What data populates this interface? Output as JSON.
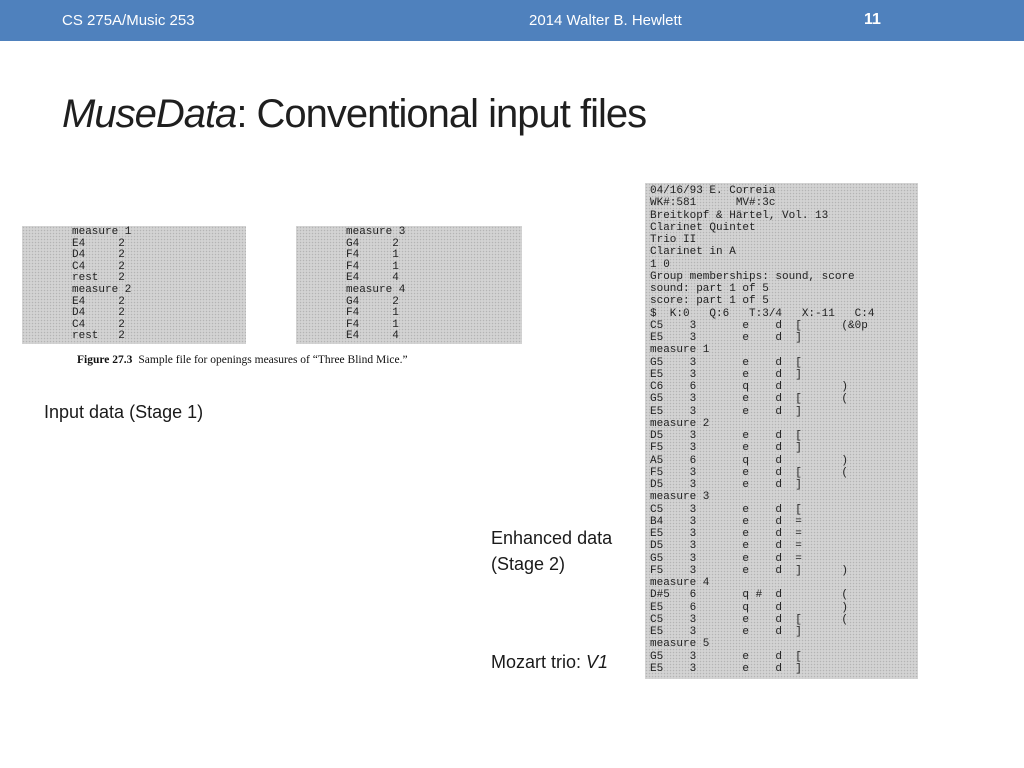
{
  "header": {
    "course": "CS 275A/Music 253",
    "credit": "2014 Walter B. Hewlett",
    "page_number": "11"
  },
  "title": {
    "italic_part": "MuseData",
    "rest": ": Conventional input files"
  },
  "stage1_figure": {
    "left_listing": "measure 1\nE4     2\nD4     2\nC4     2\nrest   2\nmeasure 2\nE4     2\nD4     2\nC4     2\nrest   2",
    "right_listing": "measure 3\nG4     2\nF4     1\nF4     1\nE4     4\nmeasure 4\nG4     2\nF4     1\nF4     1\nE4     4",
    "caption_label": "Figure 27.3",
    "caption_text": "Sample file for openings measures of “Three Blind Mice.”"
  },
  "labels": {
    "stage1": "Input data (Stage 1)",
    "stage2_line1": "Enhanced data",
    "stage2_line2": "(Stage 2)",
    "mozart_prefix": "Mozart trio: ",
    "mozart_voice": "V1"
  },
  "stage2_listing": "04/16/93 E. Correia\nWK#:581      MV#:3c\nBreitkopf & Härtel, Vol. 13\nClarinet Quintet\nTrio II\nClarinet in A\n1 0\nGroup memberships: sound, score\nsound: part 1 of 5\nscore: part 1 of 5\n$  K:0   Q:6   T:3/4   X:-11   C:4\nC5    3       e    d  [      (&0p\nE5    3       e    d  ]\nmeasure 1\nG5    3       e    d  [\nE5    3       e    d  ]\nC6    6       q    d         )\nG5    3       e    d  [      (\nE5    3       e    d  ]\nmeasure 2\nD5    3       e    d  [\nF5    3       e    d  ]\nA5    6       q    d         )\nF5    3       e    d  [      (\nD5    3       e    d  ]\nmeasure 3\nC5    3       e    d  [\nB4    3       e    d  =\nE5    3       e    d  =\nD5    3       e    d  =\nG5    3       e    d  =\nF5    3       e    d  ]      )\nmeasure 4\nD#5   6       q #  d         (\nE5    6       q    d         )\nC5    3       e    d  [      (\nE5    3       e    d  ]\nmeasure 5\nG5    3       e    d  [\nE5    3       e    d  ]"
}
